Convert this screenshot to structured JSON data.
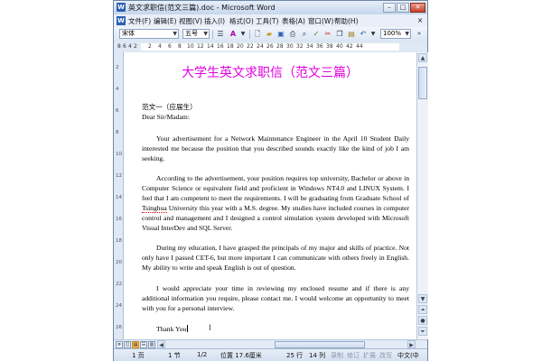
{
  "window": {
    "title": "英文求职信(范文三篇).doc - Microsoft Word",
    "icon_label": "W",
    "min_label": "–",
    "max_label": "□",
    "close_label": "✕"
  },
  "menu": {
    "items": [
      {
        "label": "文件(F)"
      },
      {
        "label": "编辑(E)"
      },
      {
        "label": "视图(V)"
      },
      {
        "label": "插入(I)"
      },
      {
        "label": "格式(O)"
      },
      {
        "label": "工具(T)"
      },
      {
        "label": "表格(A)"
      },
      {
        "label": "窗口(W)"
      },
      {
        "label": "帮助(H)"
      }
    ],
    "close_doc": "×"
  },
  "toolbar": {
    "font_name": "宋体",
    "font_size": "五号",
    "zoom": "100%"
  },
  "ruler": {
    "ticks": [
      "8",
      "6",
      "4",
      "2",
      "2",
      "4",
      "6",
      "8",
      "10",
      "12",
      "14",
      "16",
      "18",
      "20",
      "22",
      "24",
      "26",
      "28",
      "30",
      "32",
      "34",
      "36",
      "38",
      "40",
      "42",
      "44"
    ]
  },
  "vruler": {
    "ticks": [
      "2",
      "4",
      "6",
      "8",
      "10",
      "12",
      "14",
      "16",
      "18",
      "20",
      "22",
      "24",
      "26"
    ]
  },
  "document": {
    "title": "大学生英文求职信（范文三篇）",
    "heading": "范文一（应届生）",
    "salutation": "Dear Sir/Madam:",
    "p1": "Your advertisement for a Network Maintenance Engineer in the April 10 Student Daily interested me because the position that you described sounds exactly like the kind of job I am seeking.",
    "p2_a": "According to the advertisement, your position requires top university, Bachelor or above in Computer Science or equivalent field and proficient in Windows NT4.0 and LINUX System. I feel that I am competent to meet the requirements. I will be graduating from Graduate School of ",
    "p2_spell": "Tsinghua",
    "p2_b": " University this year with a M.S. degree. My studies have included courses in computer control and management and I designed a control simulation system developed with Microsoft Visual InterDev and SQL Server.",
    "p3": "During my education, I have grasped the principals of my major and skills of practice. Not only have I passed CET-6, but more important I can communicate with others freely in English. My ability to write and speak English is out of question.",
    "p4": "I would appreciate your time in reviewing my enclosed resume and if there is any additional information you require, please contact me. I would welcome an opportunity to meet with you for a personal interview.",
    "closing": "Thank You"
  },
  "status": {
    "page": "1 页",
    "section": "1 节",
    "page_of": "1/2",
    "position": "位置 17.6厘米",
    "line": "25 行",
    "col": "14 列",
    "rec": "录制",
    "rev": "修订",
    "ext": "扩展",
    "ovr": "改写",
    "lang": "中文(中"
  }
}
